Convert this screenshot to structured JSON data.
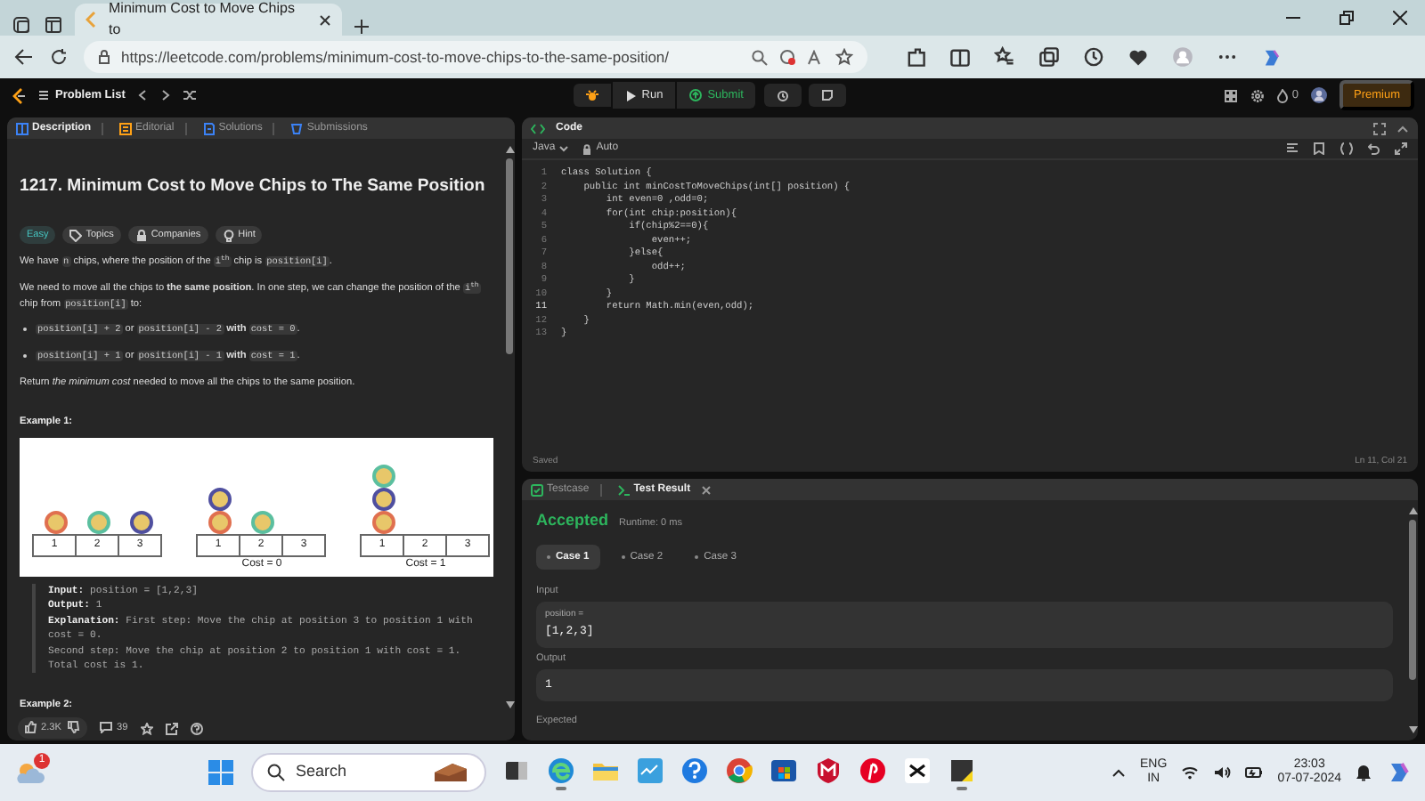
{
  "browser": {
    "tab_title": "Minimum Cost to Move Chips to",
    "url": "https://leetcode.com/problems/minimum-cost-to-move-chips-to-the-same-position/"
  },
  "leetcode_nav": {
    "problem_list": "Problem List",
    "run": "Run",
    "submit": "Submit",
    "streak": "0",
    "premium": "Premium"
  },
  "description_panel": {
    "tabs": [
      {
        "label": "Description",
        "selected": true
      },
      {
        "label": "Editorial",
        "selected": false
      },
      {
        "label": "Solutions",
        "selected": false
      },
      {
        "label": "Submissions",
        "selected": false
      }
    ],
    "title": "1217. Minimum Cost to Move Chips to The Same Position",
    "tags": [
      {
        "kind": "difficulty",
        "label": "Easy"
      },
      {
        "kind": "topics",
        "label": "Topics"
      },
      {
        "kind": "companies",
        "label": "Companies"
      },
      {
        "kind": "hint",
        "label": "Hint"
      }
    ],
    "paragraphs": [
      {
        "kind": "paragraph",
        "segments": [
          {
            "kind": "text",
            "text": "We have "
          },
          {
            "kind": "code",
            "text": "n"
          },
          {
            "kind": "text",
            "text": " chips, where the position of the "
          },
          {
            "kind": "code",
            "text": "i$^{th}$"
          },
          {
            "kind": "text",
            "text": " chip is "
          },
          {
            "kind": "code",
            "text": "position[i]"
          },
          {
            "kind": "text",
            "text": "."
          }
        ]
      },
      {
        "kind": "paragraph",
        "segments": [
          {
            "kind": "text",
            "text": "We need to move all the chips to **the same position**. In one step, we can change the position of the "
          },
          {
            "kind": "code",
            "text": "i$^{th}$"
          },
          {
            "kind": "text",
            "text": " chip from "
          },
          {
            "kind": "code",
            "text": "position[i]"
          },
          {
            "kind": "text",
            "text": " to:"
          }
        ]
      },
      {
        "kind": "bullet",
        "segments": [
          {
            "kind": "code",
            "text": "position[i] + 2"
          },
          {
            "kind": "text",
            "text": " or "
          },
          {
            "kind": "code",
            "text": "position[i] - 2"
          },
          {
            "kind": "text",
            "text": " **with** "
          },
          {
            "kind": "code",
            "text": "cost = 0"
          },
          {
            "kind": "text",
            "text": "."
          }
        ]
      },
      {
        "kind": "bullet",
        "segments": [
          {
            "kind": "code",
            "text": "position[i] + 1"
          },
          {
            "kind": "text",
            "text": " or "
          },
          {
            "kind": "code",
            "text": "position[i] - 1"
          },
          {
            "kind": "text",
            "text": " **with** "
          },
          {
            "kind": "code",
            "text": "cost = 1"
          },
          {
            "kind": "text",
            "text": "."
          }
        ]
      },
      {
        "kind": "paragraph",
        "segments": [
          {
            "kind": "text",
            "text": "Return *the minimum cost* needed to move all the chips to the same position."
          }
        ]
      }
    ],
    "example_heading": "Example 1:",
    "figure": {
      "panels": [
        {
          "columns": [
            {
              "label": "1",
              "chips": [
                {
                  "color": "#e0704f"
                }
              ]
            },
            {
              "label": "2",
              "chips": [
                {
                  "color": "#5bbf9f"
                }
              ]
            },
            {
              "label": "3",
              "chips": [
                {
                  "color": "#4f4f9f"
                }
              ]
            }
          ]
        },
        {
          "caption": "Cost = 0",
          "columns": [
            {
              "label": "1",
              "chips": [
                {
                  "color": "#e0704f"
                },
                {
                  "color": "#4f4f9f"
                }
              ]
            },
            {
              "label": "2",
              "chips": [
                {
                  "color": "#5bbf9f"
                }
              ]
            },
            {
              "label": "3"
            }
          ]
        },
        {
          "caption": "Cost = 1",
          "columns": [
            {
              "label": "1",
              "chips": [
                {
                  "color": "#e0704f"
                },
                {
                  "color": "#4f4f9f"
                },
                {
                  "color": "#5bbf9f"
                }
              ]
            },
            {
              "label": "2"
            },
            {
              "label": "3"
            }
          ]
        }
      ]
    },
    "example": [
      {
        "label": "Input:",
        "text": "position = [1,2,3]"
      },
      {
        "label": "Output:",
        "text": "1"
      },
      {
        "label": "Explanation:",
        "text": "First step: Move the chip at position 3 to position 1 with cost = 0.\nSecond step: Move the chip at position 2 to position 1 with cost = 1.\nTotal cost is 1."
      }
    ],
    "next_heading": "Example 2:",
    "footer": {
      "likes": "2.3K",
      "comments": "39"
    }
  },
  "code_panel": {
    "title": "Code",
    "language": "Java",
    "mode": "Auto",
    "lines": [
      {
        "number": "1",
        "text": "class Solution {",
        "current": false
      },
      {
        "number": "2",
        "text": "    public int minCostToMoveChips(int[] position) {",
        "current": false
      },
      {
        "number": "3",
        "text": "        int even=0 ,odd=0;",
        "current": false
      },
      {
        "number": "4",
        "text": "        for(int chip:position){",
        "current": false
      },
      {
        "number": "5",
        "text": "            if(chip%2==0){",
        "current": false
      },
      {
        "number": "6",
        "text": "                even++;",
        "current": false
      },
      {
        "number": "7",
        "text": "            }else{",
        "current": false
      },
      {
        "number": "8",
        "text": "                odd++;",
        "current": false
      },
      {
        "number": "9",
        "text": "            }",
        "current": false
      },
      {
        "number": "10",
        "text": "        }",
        "current": false
      },
      {
        "number": "11",
        "text": "        return Math.min(even,odd);",
        "current": true
      },
      {
        "number": "12",
        "text": "    }",
        "current": false
      },
      {
        "number": "13",
        "text": "}",
        "current": false
      }
    ],
    "status": "Saved",
    "cursor": "Ln 11, Col 21"
  },
  "result_panel": {
    "tabs": [
      {
        "label": "Testcase",
        "selected": false
      },
      {
        "label": "Test Result",
        "selected": true
      }
    ],
    "verdict": "Accepted",
    "runtime": "Runtime: 0 ms",
    "cases": [
      {
        "label": "Case 1",
        "selected": true
      },
      {
        "label": "Case 2",
        "selected": false
      },
      {
        "label": "Case 3",
        "selected": false
      }
    ],
    "sections": [
      {
        "label": "Input",
        "fields": [
          {
            "name": "position =",
            "value": "[1,2,3]"
          }
        ]
      },
      {
        "label": "Output",
        "fields": [
          {
            "value": "1"
          }
        ]
      },
      {
        "label": "Expected"
      }
    ]
  },
  "taskbar": {
    "weather_badge": "1",
    "search_placeholder": "Search",
    "apps": [
      {
        "kind": "taskview",
        "active": false
      },
      {
        "kind": "edge",
        "active": true
      },
      {
        "kind": "files",
        "active": false
      },
      {
        "kind": "chart",
        "active": false
      },
      {
        "kind": "help",
        "active": false
      },
      {
        "kind": "chrome",
        "active": false
      },
      {
        "kind": "store",
        "active": false
      },
      {
        "kind": "shield",
        "active": false
      },
      {
        "kind": "pin",
        "active": false
      },
      {
        "kind": "editor",
        "active": false
      },
      {
        "kind": "notes",
        "active": true
      }
    ],
    "language": "ENG",
    "region": "IN",
    "time": "23:03",
    "date": "07-07-2024"
  }
}
